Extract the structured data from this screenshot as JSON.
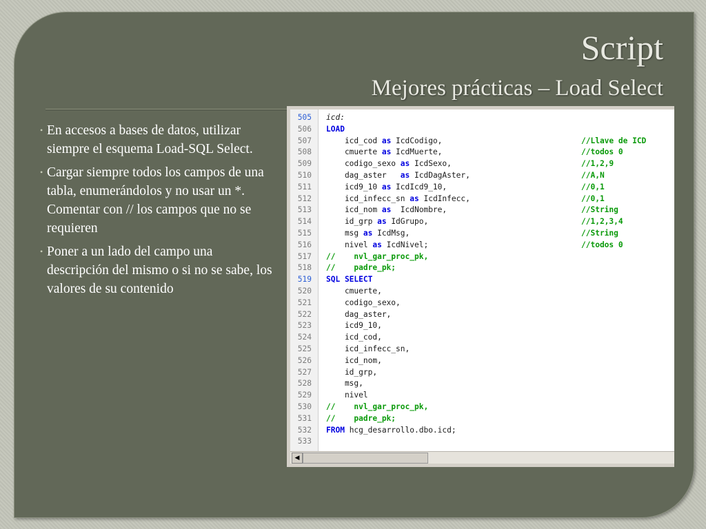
{
  "slide": {
    "title": "Script",
    "subtitle": "Mejores prácticas – Load Select",
    "bullets": [
      "En accesos a bases de datos, utilizar siempre el esquema Load-SQL Select.",
      "Cargar siempre todos los campos de una tabla, enumerándolos y no usar un *. Comentar con // los campos que no se requieren",
      "Poner a un lado del campo una descripción del mismo o si no se sabe, los valores de su contenido"
    ],
    "bullet_symbol": "•"
  },
  "editor": {
    "lines": [
      {
        "num": "505",
        "pre": "",
        "kw": "",
        "text": "icd:",
        "comment": "",
        "italic": true
      },
      {
        "num": "506",
        "pre": "",
        "kw": "LOAD",
        "text": "",
        "comment": ""
      },
      {
        "num": "507",
        "pre": "    icd_cod ",
        "kw": "as",
        "text": " IcdCodigo,",
        "comment": "//Llave de ICD"
      },
      {
        "num": "508",
        "pre": "    cmuerte ",
        "kw": "as",
        "text": " IcdMuerte,",
        "comment": "//todos 0"
      },
      {
        "num": "509",
        "pre": "    codigo_sexo ",
        "kw": "as",
        "text": " IcdSexo,",
        "comment": "//1,2,9"
      },
      {
        "num": "510",
        "pre": "    dag_aster   ",
        "kw": "as",
        "text": " IcdDagAster,",
        "comment": "//A,N"
      },
      {
        "num": "511",
        "pre": "    icd9_10 ",
        "kw": "as",
        "text": " IcdIcd9_10,",
        "comment": "//0,1"
      },
      {
        "num": "512",
        "pre": "    icd_infecc_sn ",
        "kw": "as",
        "text": " IcdInfecc,",
        "comment": "//0,1"
      },
      {
        "num": "513",
        "pre": "    icd_nom ",
        "kw": "as",
        "text": "  IcdNombre,",
        "comment": "//String"
      },
      {
        "num": "514",
        "pre": "    id_grp ",
        "kw": "as",
        "text": " IdGrupo,",
        "comment": "//1,2,3,4"
      },
      {
        "num": "515",
        "pre": "    msg ",
        "kw": "as",
        "text": " IcdMsg,",
        "comment": "//String"
      },
      {
        "num": "516",
        "pre": "    nivel ",
        "kw": "as",
        "text": " IcdNivel;",
        "comment": "//todos 0"
      },
      {
        "num": "517",
        "pre": "",
        "kw": "",
        "text": "",
        "comment": "",
        "green": "//    nvl_gar_proc_pk,"
      },
      {
        "num": "518",
        "pre": "",
        "kw": "",
        "text": "",
        "comment": "",
        "green": "//    padre_pk;"
      },
      {
        "num": "519",
        "pre": "",
        "kw": "SQL SELECT",
        "text": "",
        "comment": "",
        "blue_num": true
      },
      {
        "num": "520",
        "pre": "    cmuerte,",
        "kw": "",
        "text": "",
        "comment": ""
      },
      {
        "num": "521",
        "pre": "    codigo_sexo,",
        "kw": "",
        "text": "",
        "comment": ""
      },
      {
        "num": "522",
        "pre": "    dag_aster,",
        "kw": "",
        "text": "",
        "comment": ""
      },
      {
        "num": "523",
        "pre": "    icd9_10,",
        "kw": "",
        "text": "",
        "comment": ""
      },
      {
        "num": "524",
        "pre": "    icd_cod,",
        "kw": "",
        "text": "",
        "comment": ""
      },
      {
        "num": "525",
        "pre": "    icd_infecc_sn,",
        "kw": "",
        "text": "",
        "comment": ""
      },
      {
        "num": "526",
        "pre": "    icd_nom,",
        "kw": "",
        "text": "",
        "comment": ""
      },
      {
        "num": "527",
        "pre": "    id_grp,",
        "kw": "",
        "text": "",
        "comment": ""
      },
      {
        "num": "528",
        "pre": "    msg,",
        "kw": "",
        "text": "",
        "comment": ""
      },
      {
        "num": "529",
        "pre": "    nivel",
        "kw": "",
        "text": "",
        "comment": ""
      },
      {
        "num": "530",
        "pre": "",
        "kw": "",
        "text": "",
        "comment": "",
        "green": "//    nvl_gar_proc_pk,"
      },
      {
        "num": "531",
        "pre": "",
        "kw": "",
        "text": "",
        "comment": "",
        "green": "//    padre_pk;"
      },
      {
        "num": "532",
        "pre": "",
        "kw": "FROM",
        "text": " hcg_desarrollo.dbo.icd;",
        "comment": ""
      },
      {
        "num": "533",
        "pre": "",
        "kw": "",
        "text": "",
        "comment": ""
      }
    ],
    "scroll_left_arrow": "◀"
  }
}
